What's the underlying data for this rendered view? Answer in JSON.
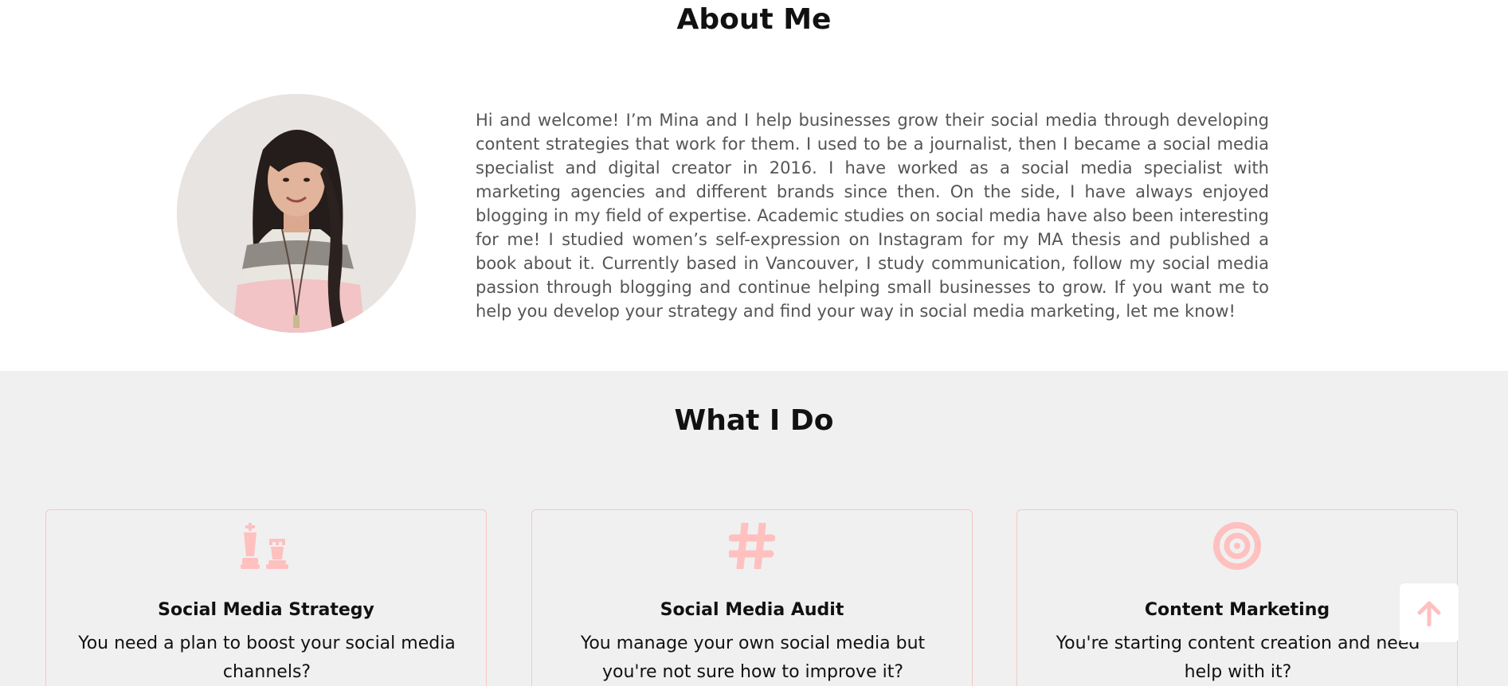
{
  "about": {
    "heading": "About Me",
    "body": "Hi and welcome! I’m Mina and I help businesses grow their social media through developing content strategies that work for them. I used to be a journalist, then I became a social media specialist and digital creator in 2016. I have worked as a social media specialist with marketing agencies and different brands since then. On the side, I have always enjoyed blogging in my field of expertise. Academic studies on social media have also been interesting for me! I studied women’s self-expression on Instagram for my MA thesis and published a book about it. Currently based in Vancouver, I study communication, follow my social media passion through blogging and continue helping small businesses to grow. If you want me to help you develop your strategy and find your way in social media marketing, let me know!"
  },
  "services": {
    "heading": "What I Do",
    "cards": [
      {
        "icon": "chess-icon",
        "title": "Social Media Strategy",
        "description": "You need a plan to boost your social media channels?"
      },
      {
        "icon": "hashtag-icon",
        "title": "Social Media Audit",
        "description": "You manage your own social media but you're not sure how to improve it?"
      },
      {
        "icon": "target-icon",
        "title": "Content Marketing",
        "description": "You're starting content creation and need help with it?"
      }
    ]
  },
  "scroll_top": {
    "icon": "arrow-up-icon"
  },
  "colors": {
    "accent_pink": "#ffc0c0",
    "section_gray": "#f0f0f0",
    "card_border": "#f6c7c7",
    "body_text": "#555555"
  }
}
